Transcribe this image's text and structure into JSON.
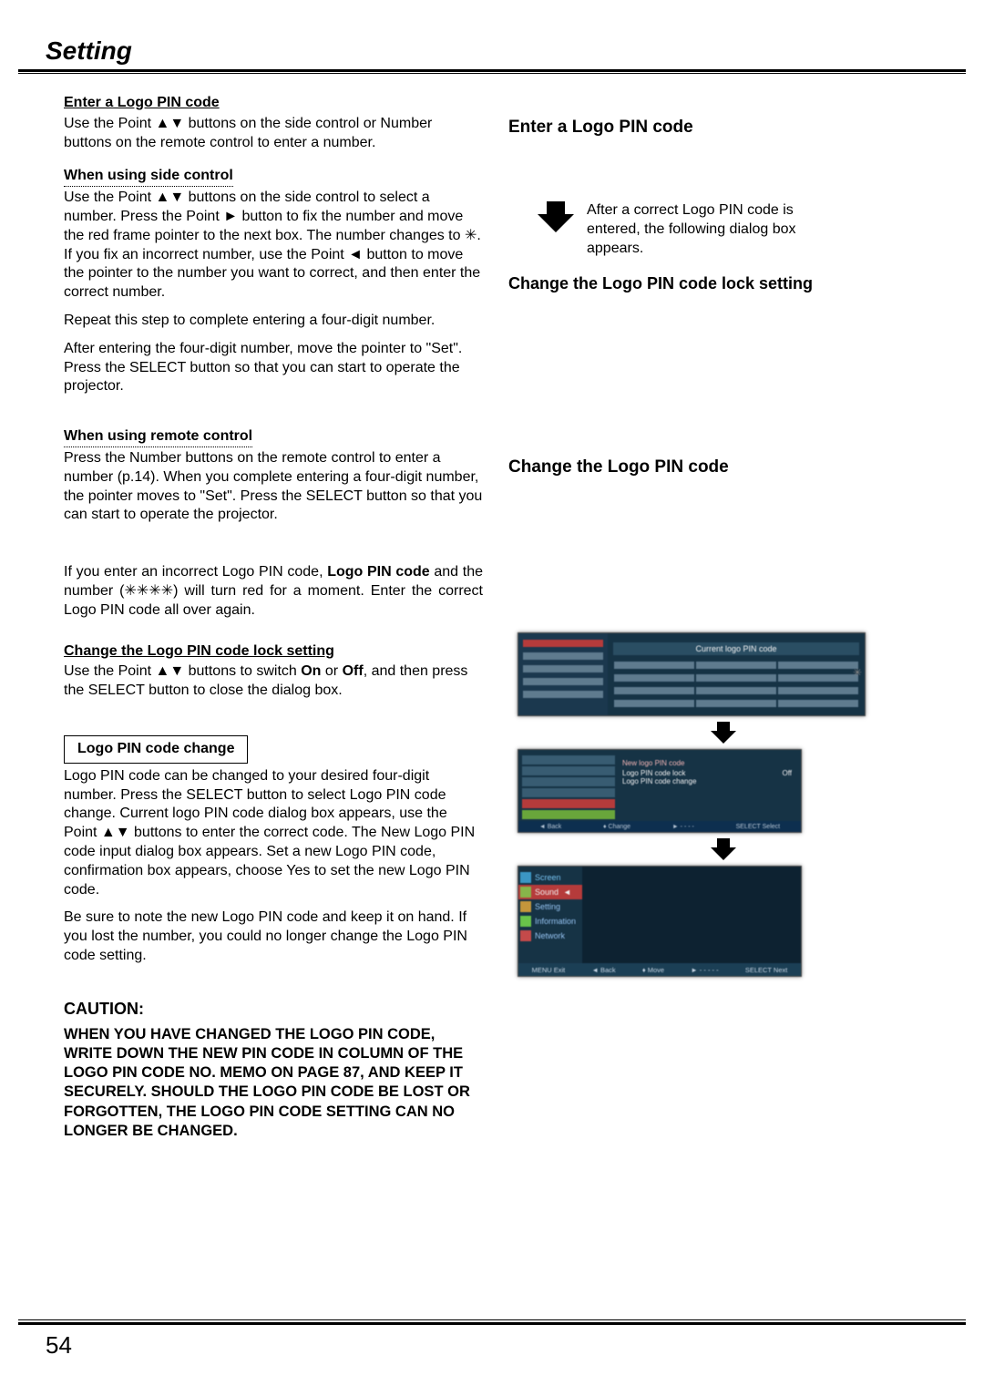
{
  "header": "Setting",
  "page_number": "54",
  "left": {
    "h_enter": "Enter a Logo PIN code",
    "p_enter": "Use the Point ▲▼ buttons on the side control or Number buttons on the remote control to enter a number.",
    "h_side": "When using side control",
    "p_side": "Use the Point ▲▼ buttons on the side control to select a number. Press the Point ► button to fix the number and move the red frame pointer to the next box. The number changes to ✳. If you fix an incorrect number, use the Point ◄ button to move the pointer to the number you want to correct, and then enter the correct number.",
    "p_repeat": "Repeat this step to complete entering a four-digit number.",
    "p_after4": "After entering the four-digit number, move the pointer to \"Set\". Press the SELECT button so that you can start to operate the projector.",
    "h_remote": "When using remote control",
    "p_remote": "Press the Number buttons on the remote control to enter a number (p.14). When you complete entering a four-digit number, the pointer moves to \"Set\". Press the SELECT button so that you can start to operate the projector.",
    "p_incorrect_a": "If you enter an incorrect Logo PIN code, ",
    "p_incorrect_b": "Logo PIN code",
    "p_incorrect_c": " and the number (✳✳✳✳) will turn red for a moment. Enter the correct Logo PIN code all over again.",
    "h_changelock": "Change the Logo PIN code lock setting",
    "p_changelock_a": "Use the Point ▲▼ buttons to switch ",
    "p_changelock_on": "On",
    "p_changelock_mid": " or ",
    "p_changelock_off": "Off",
    "p_changelock_b": ", and then press the SELECT button to close the dialog box.",
    "box_change": "Logo PIN code change",
    "p_change": "Logo PIN code can be changed to your desired four-digit number. Press the SELECT button to select Logo PIN code change. Current logo PIN code dialog box appears, use the Point ▲▼ buttons to enter the correct code. The New Logo PIN code input dialog box appears. Set a new Logo PIN code, confirmation box appears, choose Yes to set the new Logo PIN code.",
    "p_note": "Be sure to note the new Logo PIN code and keep it on hand. If you lost the number, you could no longer change the Logo PIN code setting.",
    "caution_h": "CAUTION:",
    "caution_b": "when you have changed THE LOGO PIn code, write down the new pin code in column of the LOGO pin code no. memo on page 87, and keep it securely. should the LOGO pin code be lost or forgotten, the LOGO pin code setting can no longer be changed."
  },
  "right": {
    "h1": "Enter a Logo PIN code",
    "arrow_text": "After a correct Logo PIN code is entered, the following dialog box appears.",
    "h2": "Change the Logo PIN code lock setting",
    "h3": "Change the Logo PIN code",
    "mock1": {
      "title": "Current logo PIN code",
      "side_mask": "✳ ✳✳✳✳ ✳"
    },
    "mock2": {
      "new_label": "New logo PIN code",
      "opt1": "Logo PIN code lock",
      "opt2": "Logo PIN code change",
      "val": "Off",
      "foot_back": "◄ Back",
      "foot_change": "♦ Change",
      "foot_select": "SELECT Select"
    },
    "mock3": {
      "m_screen": "Screen",
      "m_sound": "Sound",
      "m_setting": "Setting",
      "m_info": "Information",
      "m_network": "Network",
      "foot_exit": "MENU Exit",
      "foot_back": "◄ Back",
      "foot_move": "♦ Move",
      "foot_dash": "► - - - - -",
      "foot_next": "SELECT Next"
    }
  }
}
